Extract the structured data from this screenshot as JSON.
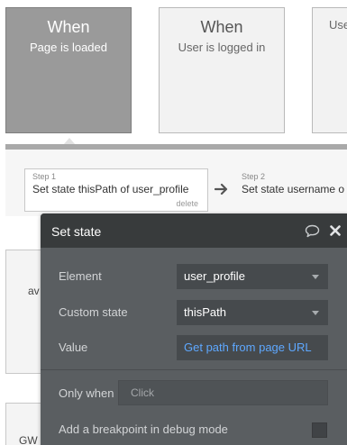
{
  "events": [
    {
      "title": "When",
      "subtitle": "Page is loaded",
      "active": true
    },
    {
      "title": "When",
      "subtitle": "User is logged in",
      "active": false
    },
    {
      "title": "",
      "subtitle": "Use",
      "active": false
    }
  ],
  "steps": [
    {
      "label": "Step 1",
      "text": "Set state thisPath of user_profile",
      "delete": "delete"
    },
    {
      "label": "Step 2",
      "text": "Set state username o"
    }
  ],
  "background": {
    "box1_text": "av",
    "box2_text": "GW"
  },
  "panel": {
    "title": "Set state",
    "element_label": "Element",
    "element_value": "user_profile",
    "custom_state_label": "Custom state",
    "custom_state_value": "thisPath",
    "value_label": "Value",
    "value_link": "Get path from page URL",
    "only_when_label": "Only when",
    "only_when_placeholder": "Click",
    "breakpoint_label": "Add a breakpoint in debug mode"
  },
  "icons": {
    "comment": "comment-icon",
    "close": "close-icon",
    "arrow": "arrow-right-icon",
    "caret": "chevron-down-icon"
  },
  "colors": {
    "link": "#5ea8ff",
    "panel_bg": "#5a5e61",
    "panel_header": "#383b3c",
    "active_event": "#9a9a9a"
  }
}
